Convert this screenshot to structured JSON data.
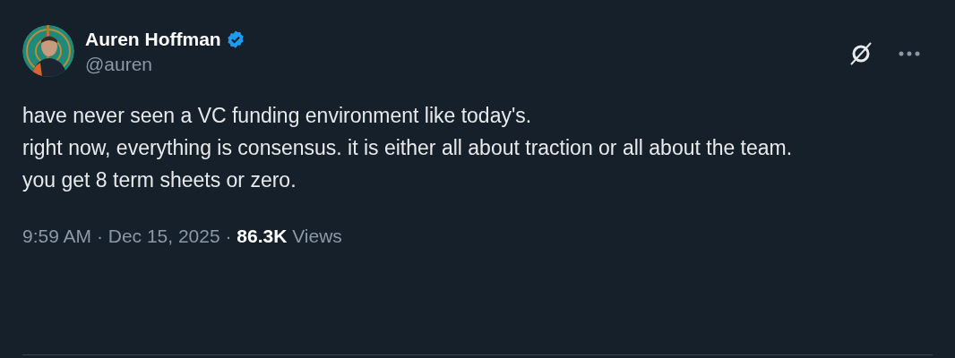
{
  "author": {
    "name": "Auren Hoffman",
    "verified": true,
    "handle": "@auren"
  },
  "body": [
    "have never seen a VC funding environment like today's.",
    "right now, everything is consensus.  it is either all about traction or all about the team.",
    "you get 8 term sheets or zero."
  ],
  "footer": "9:59 AM · Dec 15, 2025 · **86.3K** Views"
}
